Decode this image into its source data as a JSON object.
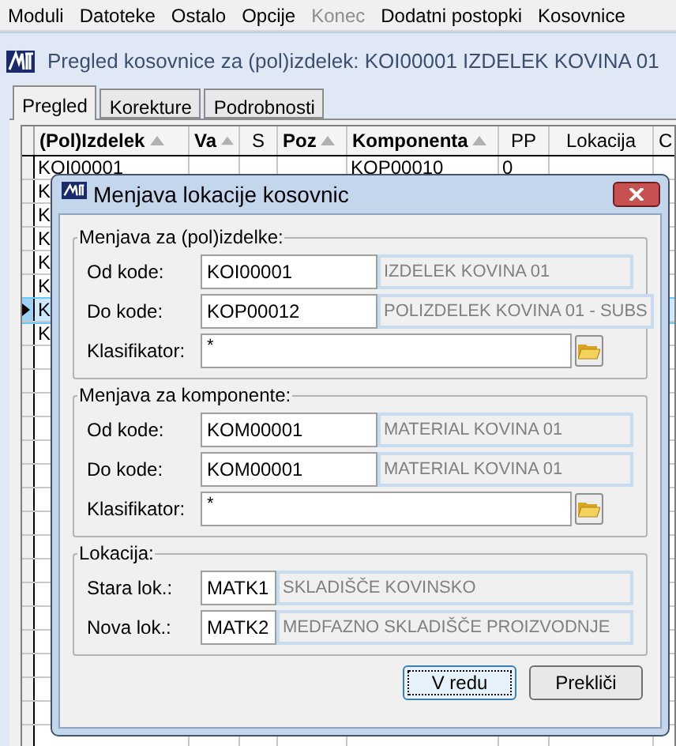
{
  "menu": [
    {
      "label": "Moduli",
      "disabled": false
    },
    {
      "label": "Datoteke",
      "disabled": false
    },
    {
      "label": "Ostalo",
      "disabled": false
    },
    {
      "label": "Opcije",
      "disabled": false
    },
    {
      "label": "Konec",
      "disabled": true
    },
    {
      "label": "Dodatni postopki",
      "disabled": false
    },
    {
      "label": "Kosovnice",
      "disabled": false
    }
  ],
  "window": {
    "title": "Pregled kosovnice za (pol)izdelek: KOI00001 IZDELEK KOVINA 01"
  },
  "tabs": [
    {
      "label": "Pregled",
      "selected": true
    },
    {
      "label": "Korekture",
      "selected": false
    },
    {
      "label": "Podrobnosti",
      "selected": false
    }
  ],
  "grid": {
    "columns": [
      {
        "label": "(Pol)Izdelek",
        "sortable": true
      },
      {
        "label": "Va",
        "sortable": true
      },
      {
        "label": "S",
        "sortable": false
      },
      {
        "label": "Poz",
        "sortable": true
      },
      {
        "label": "Komponenta",
        "sortable": true
      },
      {
        "label": "PP",
        "sortable": false
      },
      {
        "label": "Lokacija",
        "sortable": false
      },
      {
        "label": "C",
        "sortable": false
      }
    ],
    "rows": [
      {
        "cells": [
          "KOI00001",
          "",
          "",
          "",
          "KOP00010",
          "0",
          "",
          ""
        ],
        "selected": false
      },
      {
        "cells": [
          "K"
        ],
        "selected": false
      },
      {
        "cells": [
          "K"
        ],
        "selected": false
      },
      {
        "cells": [
          "K"
        ],
        "selected": false
      },
      {
        "cells": [
          "K"
        ],
        "selected": false
      },
      {
        "cells": [
          "K"
        ],
        "selected": false
      },
      {
        "cells": [
          "K"
        ],
        "selected": true
      },
      {
        "cells": [
          "K"
        ],
        "selected": false
      }
    ]
  },
  "dialog": {
    "title": "Menjava lokacije kosovnic",
    "groups": [
      {
        "title": "Menjava za (pol)izdelke:",
        "fields": [
          {
            "kind": "code",
            "label": "Od kode:",
            "value": "KOI00001",
            "description": "IZDELEK KOVINA 01"
          },
          {
            "kind": "code",
            "label": "Do kode:",
            "value": "KOP00012",
            "description": "POLIZDELEK KOVINA 01 - SUBS"
          },
          {
            "kind": "browse",
            "label": "Klasifikator:",
            "value": "*"
          }
        ]
      },
      {
        "title": "Menjava za komponente:",
        "fields": [
          {
            "kind": "code",
            "label": "Od kode:",
            "value": "KOM00001",
            "description": "MATERIAL KOVINA 01"
          },
          {
            "kind": "code",
            "label": "Do kode:",
            "value": "KOM00001",
            "description": "MATERIAL KOVINA 01"
          },
          {
            "kind": "browse",
            "label": "Klasifikator:",
            "value": "*"
          }
        ]
      },
      {
        "title": "Lokacija:",
        "fields": [
          {
            "kind": "location",
            "label": "Stara lok.:",
            "value": "MATK1",
            "description": "SKLADIŠČE KOVINSKO"
          },
          {
            "kind": "location",
            "label": "Nova lok.:",
            "value": "MATK2",
            "description": "MEDFAZNO SKLADIŠČE PROIZVODNJE"
          }
        ]
      }
    ],
    "buttons": [
      {
        "label": "V redu",
        "default": true
      },
      {
        "label": "Prekliči",
        "default": false
      }
    ]
  }
}
